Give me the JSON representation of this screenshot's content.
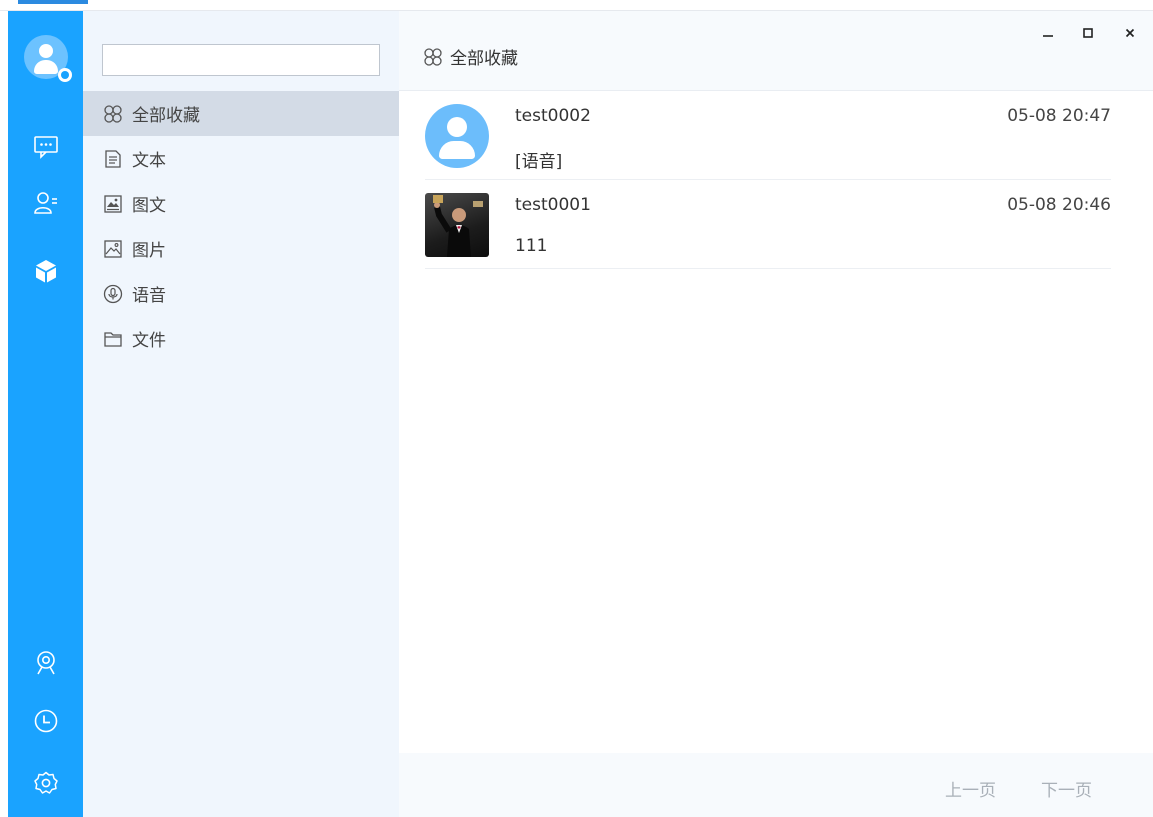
{
  "colors": {
    "rail": "#1aa3ff",
    "sidebar": "#f0f6fd",
    "active_nav": "#d3dbe6",
    "avatar_default": "#6cbdfb"
  },
  "rail": {
    "icons": [
      "user-avatar",
      "chat-icon",
      "contacts-icon",
      "favorites-cube-icon",
      "camera-icon",
      "clock-icon",
      "settings-icon"
    ]
  },
  "search": {
    "value": "",
    "placeholder": ""
  },
  "nav": {
    "items": [
      {
        "label": "全部收藏",
        "icon": "all-favorites-icon",
        "active": true
      },
      {
        "label": "文本",
        "icon": "text-doc-icon",
        "active": false
      },
      {
        "label": "图文",
        "icon": "image-text-icon",
        "active": false
      },
      {
        "label": "图片",
        "icon": "picture-icon",
        "active": false
      },
      {
        "label": "语音",
        "icon": "voice-icon",
        "active": false
      },
      {
        "label": "文件",
        "icon": "folder-icon",
        "active": false
      }
    ]
  },
  "header": {
    "title": "全部收藏"
  },
  "window": {
    "minimize": "–",
    "maximize": "□",
    "close": "×"
  },
  "list": {
    "items": [
      {
        "name": "test0002",
        "message": "[语音]",
        "time": "05-08 20:47",
        "avatar": "default-avatar"
      },
      {
        "name": "test0001",
        "message": "111",
        "time": "05-08 20:46",
        "avatar": "photo-avatar"
      }
    ]
  },
  "pager": {
    "prev": "上一页",
    "next": "下一页"
  }
}
